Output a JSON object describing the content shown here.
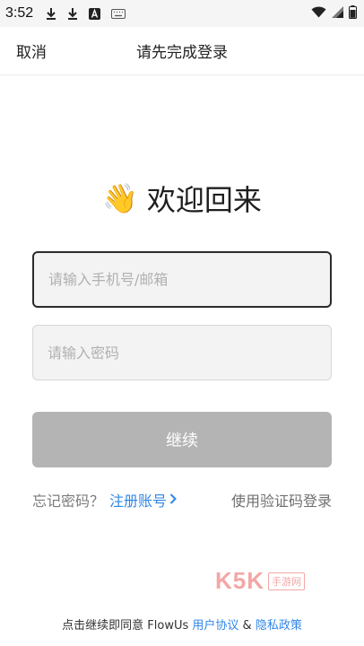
{
  "status_bar": {
    "time": "3:52",
    "icons": [
      "download-icon",
      "download-icon",
      "a-badge-icon",
      "keyboard-icon",
      "wifi-icon",
      "signal-icon",
      "battery-icon"
    ]
  },
  "header": {
    "cancel_label": "取消",
    "title": "请先完成登录"
  },
  "welcome": {
    "emoji": "👋",
    "text": "欢迎回来"
  },
  "form": {
    "phone_placeholder": "请输入手机号/邮箱",
    "phone_value": "",
    "password_placeholder": "请输入密码",
    "password_value": "",
    "continue_label": "继续"
  },
  "links": {
    "forgot": "忘记密码？",
    "register": "注册账号",
    "code_login": "使用验证码登录"
  },
  "watermark": {
    "brand": "K5K",
    "tag": "手游网"
  },
  "footer": {
    "prefix": "点击继续即同意 FlowUs",
    "user_agreement": "用户协议",
    "and": "&",
    "privacy": "隐私政策"
  },
  "colors": {
    "link": "#2f86e8",
    "button_disabled": "#b4b4b4",
    "focused_border": "#2b2b2b"
  }
}
